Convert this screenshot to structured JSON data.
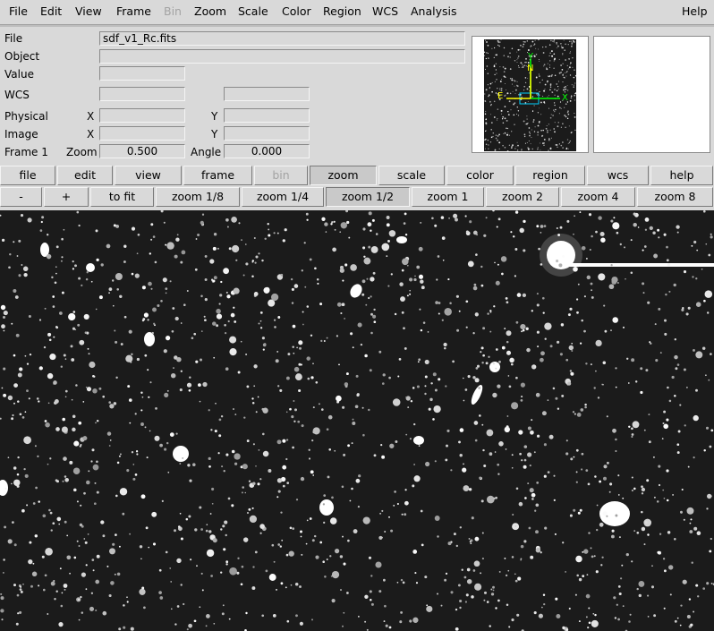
{
  "menubar": {
    "items": [
      "File",
      "Edit",
      "View",
      "Frame",
      "Bin",
      "Zoom",
      "Scale",
      "Color",
      "Region",
      "WCS",
      "Analysis"
    ],
    "disabled_item": "Bin",
    "help": "Help"
  },
  "info": {
    "file_label": "File",
    "file_value": "sdf_v1_Rc.fits",
    "object_label": "Object",
    "object_value": "",
    "value_label": "Value",
    "value_value": "",
    "wcs_label": "WCS",
    "physical_label": "Physical",
    "image_label": "Image",
    "x_label": "X",
    "y_label": "Y",
    "frame_label": "Frame 1",
    "zoom_label": "Zoom",
    "zoom_value": "0.500",
    "angle_label": "Angle",
    "angle_value": "0.000"
  },
  "panner": {
    "north_label": "N",
    "east_label": "E",
    "y_label": "Y",
    "x_label": "X",
    "compass_color": "#ffff00",
    "axis_color": "#00ff00",
    "box_color": "#00d0ff"
  },
  "buttonbar": {
    "items": [
      "file",
      "edit",
      "view",
      "frame",
      "bin",
      "zoom",
      "scale",
      "color",
      "region",
      "wcs",
      "help"
    ],
    "disabled_item": "bin",
    "active_item": "zoom"
  },
  "zoombar": {
    "items": [
      "-",
      "+",
      "to fit",
      "zoom 1/8",
      "zoom 1/4",
      "zoom 1/2",
      "zoom 1",
      "zoom 2",
      "zoom 4",
      "zoom 8"
    ],
    "active_item": "zoom 1/2"
  },
  "image": {
    "background_color": "#1b1b1b"
  }
}
